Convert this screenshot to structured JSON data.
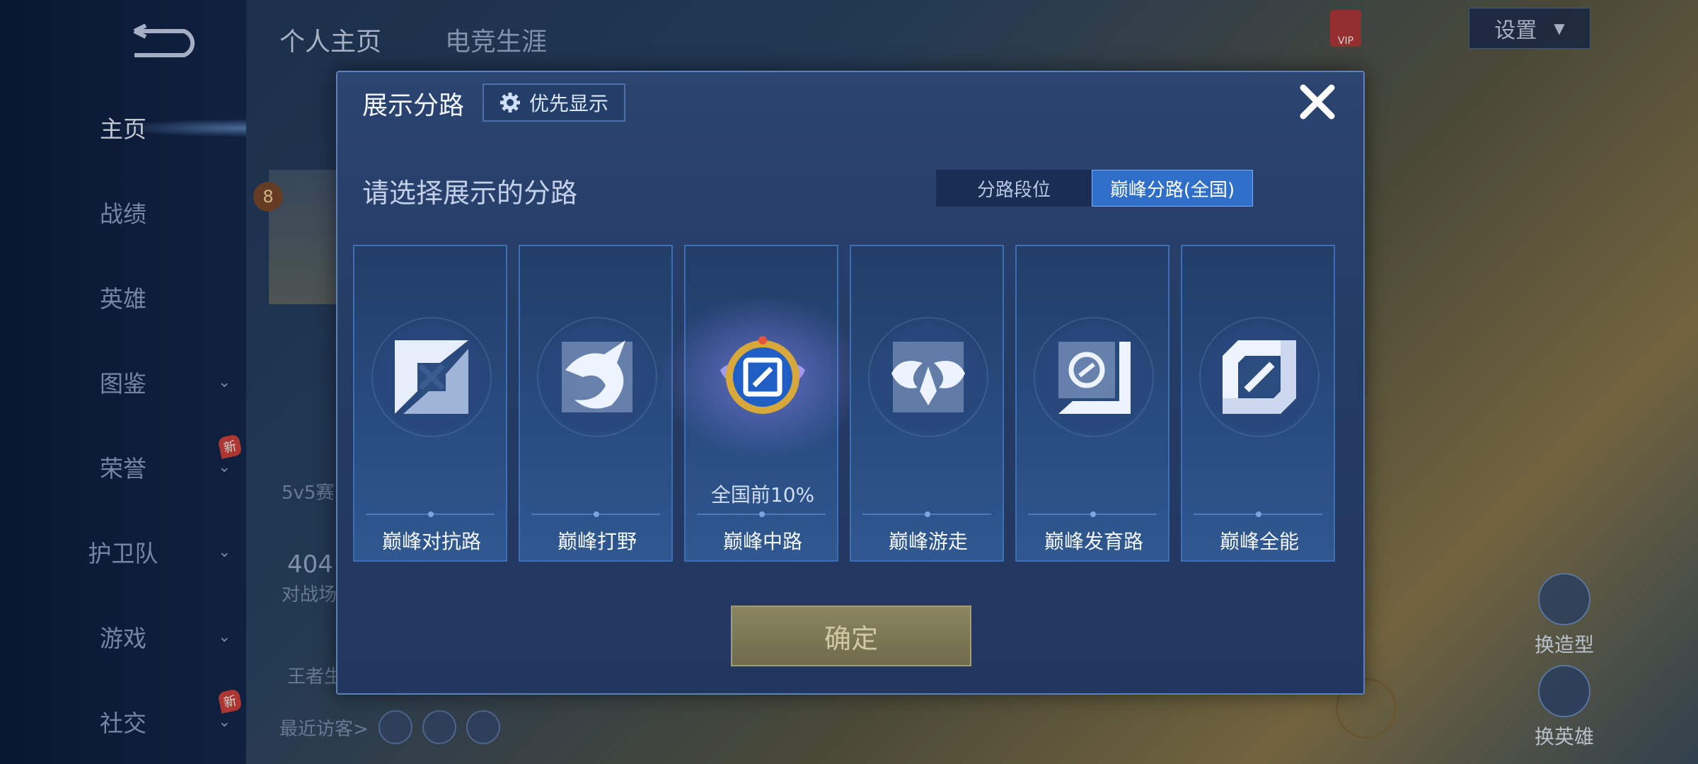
{
  "sidebar": {
    "items": [
      {
        "label": "主页",
        "active": true
      },
      {
        "label": "战绩"
      },
      {
        "label": "英雄"
      },
      {
        "label": "图鉴",
        "chevron": true
      },
      {
        "label": "荣誉",
        "chevron": true,
        "badge": "新"
      },
      {
        "label": "护卫队",
        "chevron": true
      },
      {
        "label": "游戏",
        "chevron": true
      },
      {
        "label": "社交",
        "chevron": true,
        "badge": "新"
      }
    ]
  },
  "background": {
    "tabs": [
      "个人主页",
      "电竞生涯"
    ],
    "settings_label": "设置",
    "vip_label": "VIP",
    "level": "8",
    "mode_text": "5v5赛",
    "count_text": "404",
    "count_sub": "对战场",
    "bottom_left_text": "王者生",
    "recent_visitors_label": "最近访客>",
    "change_model_label": "换造型",
    "change_hero_label": "换英雄",
    "right_badge": "新"
  },
  "modal": {
    "title": "展示分路",
    "priority_label": "优先显示",
    "subtitle": "请选择展示的分路",
    "toggle": {
      "option_a": "分路段位",
      "option_b": "巅峰分路(全国)",
      "selected": "option_b"
    },
    "cards": [
      {
        "label": "巅峰对抗路",
        "icon": "clash-lane-icon"
      },
      {
        "label": "巅峰打野",
        "icon": "jungle-dragon-icon"
      },
      {
        "label": "巅峰中路",
        "icon": "mid-lane-icon",
        "selected": true,
        "rank": "全国前10%"
      },
      {
        "label": "巅峰游走",
        "icon": "roam-wings-icon"
      },
      {
        "label": "巅峰发育路",
        "icon": "farm-lane-icon"
      },
      {
        "label": "巅峰全能",
        "icon": "all-round-icon"
      }
    ],
    "confirm_label": "确定"
  },
  "colors": {
    "accent": "#2f6fc9",
    "modal_bg": "#243b63",
    "confirm_bg": "#8a8560"
  }
}
